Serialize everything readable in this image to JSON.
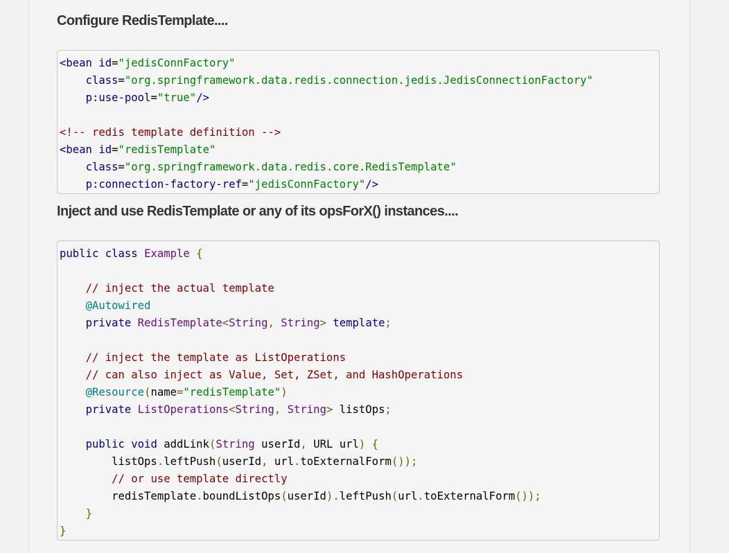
{
  "headings": {
    "configure": "Configure RedisTemplate....",
    "inject": "Inject and use RedisTemplate or any of its opsForX() instances...."
  },
  "xml_code": {
    "lines": [
      [
        {
          "t": "tag",
          "v": "<bean "
        },
        {
          "t": "attr",
          "v": "id"
        },
        {
          "t": "eq",
          "v": "="
        },
        {
          "t": "str",
          "v": "\"jedisConnFactory\""
        }
      ],
      [
        {
          "t": "plain",
          "v": "    "
        },
        {
          "t": "attr",
          "v": "class"
        },
        {
          "t": "eq",
          "v": "="
        },
        {
          "t": "str",
          "v": "\"org.springframework.data.redis.connection.jedis.JedisConnectionFactory\""
        }
      ],
      [
        {
          "t": "plain",
          "v": "    "
        },
        {
          "t": "attr",
          "v": "p:use-pool"
        },
        {
          "t": "eq",
          "v": "="
        },
        {
          "t": "str",
          "v": "\"true\""
        },
        {
          "t": "tag",
          "v": "/>"
        }
      ],
      [],
      [
        {
          "t": "comment",
          "v": "<!-- redis template definition -->"
        }
      ],
      [
        {
          "t": "tag",
          "v": "<bean "
        },
        {
          "t": "attr",
          "v": "id"
        },
        {
          "t": "eq",
          "v": "="
        },
        {
          "t": "str",
          "v": "\"redisTemplate\""
        }
      ],
      [
        {
          "t": "plain",
          "v": "    "
        },
        {
          "t": "attr",
          "v": "class"
        },
        {
          "t": "eq",
          "v": "="
        },
        {
          "t": "str",
          "v": "\"org.springframework.data.redis.core.RedisTemplate\""
        }
      ],
      [
        {
          "t": "plain",
          "v": "    "
        },
        {
          "t": "attr",
          "v": "p:connection-factory-ref"
        },
        {
          "t": "eq",
          "v": "="
        },
        {
          "t": "str",
          "v": "\"jedisConnFactory\""
        },
        {
          "t": "tag",
          "v": "/>"
        }
      ]
    ]
  },
  "java_code": {
    "lines": [
      [
        {
          "t": "kw",
          "v": "public class "
        },
        {
          "t": "type",
          "v": "Example"
        },
        {
          "t": "punct",
          "v": " {"
        }
      ],
      [],
      [
        {
          "t": "plain",
          "v": "    "
        },
        {
          "t": "comment",
          "v": "// inject the actual template"
        }
      ],
      [
        {
          "t": "plain",
          "v": "    "
        },
        {
          "t": "ann",
          "v": "@Autowired"
        }
      ],
      [
        {
          "t": "plain",
          "v": "    "
        },
        {
          "t": "kw",
          "v": "private "
        },
        {
          "t": "type",
          "v": "RedisTemplate"
        },
        {
          "t": "punct",
          "v": "<"
        },
        {
          "t": "type",
          "v": "String"
        },
        {
          "t": "punct",
          "v": ", "
        },
        {
          "t": "type",
          "v": "String"
        },
        {
          "t": "punct",
          "v": "> "
        },
        {
          "t": "kw",
          "v": "template"
        },
        {
          "t": "punct",
          "v": ";"
        }
      ],
      [],
      [
        {
          "t": "plain",
          "v": "    "
        },
        {
          "t": "comment",
          "v": "// inject the template as ListOperations"
        }
      ],
      [
        {
          "t": "plain",
          "v": "    "
        },
        {
          "t": "comment",
          "v": "// can also inject as Value, Set, ZSet, and HashOperations"
        }
      ],
      [
        {
          "t": "plain",
          "v": "    "
        },
        {
          "t": "ann",
          "v": "@Resource"
        },
        {
          "t": "punct",
          "v": "("
        },
        {
          "t": "plain",
          "v": "name"
        },
        {
          "t": "punct",
          "v": "="
        },
        {
          "t": "str",
          "v": "\"redisTemplate\""
        },
        {
          "t": "punct",
          "v": ")"
        }
      ],
      [
        {
          "t": "plain",
          "v": "    "
        },
        {
          "t": "kw",
          "v": "private "
        },
        {
          "t": "type",
          "v": "ListOperations"
        },
        {
          "t": "punct",
          "v": "<"
        },
        {
          "t": "type",
          "v": "String"
        },
        {
          "t": "punct",
          "v": ", "
        },
        {
          "t": "type",
          "v": "String"
        },
        {
          "t": "punct",
          "v": "> "
        },
        {
          "t": "plain",
          "v": "listOps"
        },
        {
          "t": "punct",
          "v": ";"
        }
      ],
      [],
      [
        {
          "t": "plain",
          "v": "    "
        },
        {
          "t": "kw",
          "v": "public void "
        },
        {
          "t": "plain",
          "v": "addLink"
        },
        {
          "t": "punct",
          "v": "("
        },
        {
          "t": "type",
          "v": "String"
        },
        {
          "t": "plain",
          "v": " userId"
        },
        {
          "t": "punct",
          "v": ", "
        },
        {
          "t": "plain",
          "v": "URL url"
        },
        {
          "t": "punct",
          "v": ") {"
        }
      ],
      [
        {
          "t": "plain",
          "v": "        listOps"
        },
        {
          "t": "punct",
          "v": "."
        },
        {
          "t": "plain",
          "v": "leftPush"
        },
        {
          "t": "punct",
          "v": "("
        },
        {
          "t": "plain",
          "v": "userId"
        },
        {
          "t": "punct",
          "v": ", "
        },
        {
          "t": "plain",
          "v": "url"
        },
        {
          "t": "punct",
          "v": "."
        },
        {
          "t": "plain",
          "v": "toExternalForm"
        },
        {
          "t": "punct",
          "v": "());"
        }
      ],
      [
        {
          "t": "plain",
          "v": "        "
        },
        {
          "t": "comment",
          "v": "// or use template directly"
        }
      ],
      [
        {
          "t": "plain",
          "v": "        redisTemplate"
        },
        {
          "t": "punct",
          "v": "."
        },
        {
          "t": "plain",
          "v": "boundListOps"
        },
        {
          "t": "punct",
          "v": "("
        },
        {
          "t": "plain",
          "v": "userId"
        },
        {
          "t": "punct",
          "v": ")."
        },
        {
          "t": "plain",
          "v": "leftPush"
        },
        {
          "t": "punct",
          "v": "("
        },
        {
          "t": "plain",
          "v": "url"
        },
        {
          "t": "punct",
          "v": "."
        },
        {
          "t": "plain",
          "v": "toExternalForm"
        },
        {
          "t": "punct",
          "v": "());"
        }
      ],
      [
        {
          "t": "plain",
          "v": "    "
        },
        {
          "t": "punct",
          "v": "}"
        }
      ],
      [
        {
          "t": "punct",
          "v": "}"
        }
      ]
    ]
  }
}
